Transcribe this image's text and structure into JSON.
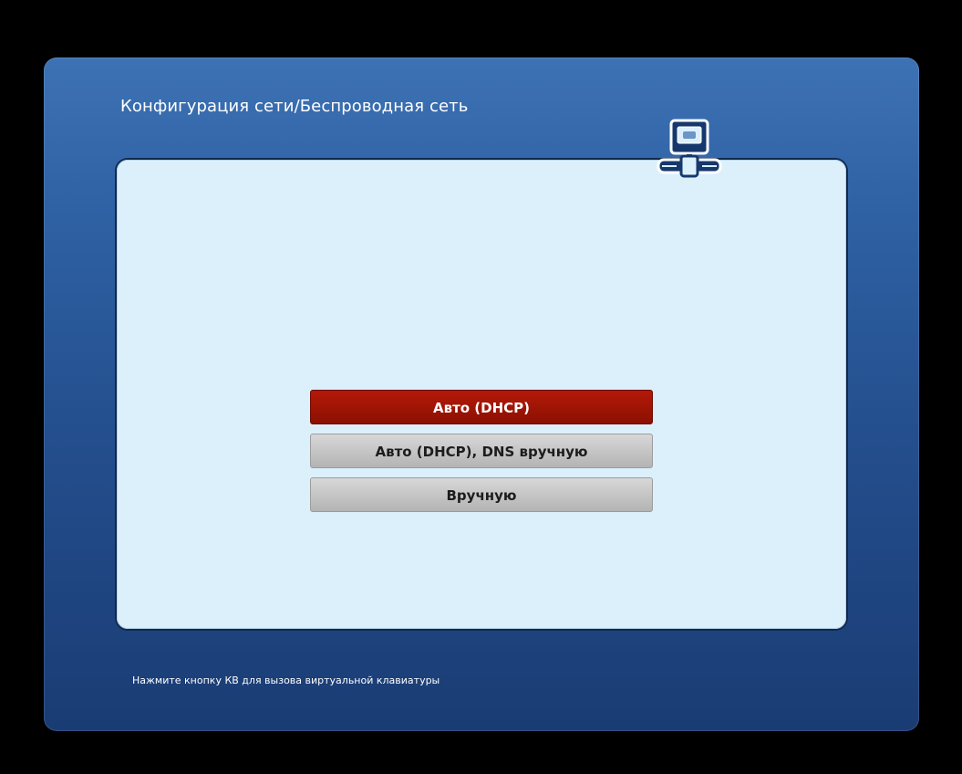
{
  "dialog": {
    "title": "Конфигурация сети/Беспроводная сеть",
    "icon": "network-computer-icon",
    "options": [
      {
        "label": "Авто (DHCP)",
        "selected": true
      },
      {
        "label": "Авто (DHCP), DNS вручную",
        "selected": false
      },
      {
        "label": "Вручную",
        "selected": false
      }
    ],
    "hint": "Нажмите кнопку КВ для вызова виртуальной клавиатуры"
  },
  "colors": {
    "dialog_background": "#2f62a4",
    "panel_background": "#dcf0fc",
    "selected_option": "#9c1404",
    "unselected_option": "#c6c6c6"
  }
}
